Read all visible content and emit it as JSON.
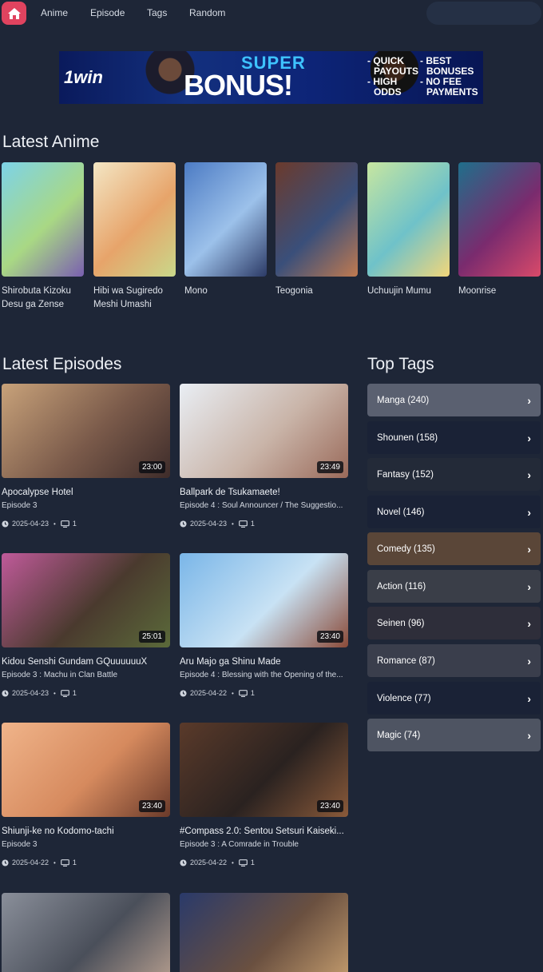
{
  "nav": {
    "links": [
      "Anime",
      "Episode",
      "Tags",
      "Random"
    ]
  },
  "banner": {
    "brand": "1win",
    "headline_top": "SUPER",
    "headline_main": "BONUS!",
    "col1": [
      "- QUICK",
      "PAYOUTS",
      "- HIGH",
      "ODDS"
    ],
    "col2": [
      "- BEST",
      "BONUSES",
      "- NO FEE",
      "PAYMENTS"
    ]
  },
  "latest_anime": {
    "heading": "Latest Anime",
    "items": [
      {
        "title": "Shirobuta Kizoku Desu ga Zense no...",
        "colors": [
          "#7dd3e8",
          "#a9d884",
          "#7a5fb0"
        ]
      },
      {
        "title": "Hibi wa Sugiredo Meshi Umashi",
        "colors": [
          "#f3e6c4",
          "#e7a46a",
          "#c9d88a"
        ]
      },
      {
        "title": "Mono",
        "colors": [
          "#4c7bc4",
          "#9cc1ea",
          "#2c3a66"
        ]
      },
      {
        "title": "Teogonia",
        "colors": [
          "#6b3a2c",
          "#3a4f7a",
          "#c07a50"
        ]
      },
      {
        "title": "Uchuujin Mumu",
        "colors": [
          "#c7e6a0",
          "#6fc2c9",
          "#f2d67a"
        ]
      },
      {
        "title": "Moonrise",
        "colors": [
          "#1f6f8b",
          "#7a2b6e",
          "#d94a6a"
        ]
      }
    ]
  },
  "latest_episodes": {
    "heading": "Latest Episodes",
    "items": [
      {
        "title": "Apocalypse Hotel",
        "subtitle": "Episode 3",
        "duration": "23:00",
        "date": "2025-04-23",
        "count": "1",
        "colors": [
          "#c8a27a",
          "#7a5a4a",
          "#3e2c2a"
        ]
      },
      {
        "title": "Ballpark de Tsukamaete!",
        "subtitle": "Episode 4 : Soul Announcer / The Suggestio...",
        "duration": "23:49",
        "date": "2025-04-23",
        "count": "1",
        "colors": [
          "#e9eef4",
          "#c9b4a8",
          "#9a6a5a"
        ]
      },
      {
        "title": "Kidou Senshi Gundam GQuuuuuuX",
        "subtitle": "Episode 3 : Machu in Clan Battle",
        "duration": "25:01",
        "date": "2025-04-23",
        "count": "1",
        "colors": [
          "#c05a9a",
          "#4a3a2e",
          "#5b6a3a"
        ]
      },
      {
        "title": "Aru Majo ga Shinu Made",
        "subtitle": "Episode 4 : Blessing with the Opening of the...",
        "duration": "23:40",
        "date": "2025-04-22",
        "count": "1",
        "colors": [
          "#7ab6e8",
          "#c8e2f4",
          "#8a4a38"
        ]
      },
      {
        "title": "Shiunji-ke no Kodomo-tachi",
        "subtitle": "Episode 3",
        "duration": "23:40",
        "date": "2025-04-22",
        "count": "1",
        "colors": [
          "#f0b48a",
          "#d68a5e",
          "#6a3a2a"
        ]
      },
      {
        "title": "#Compass 2.0: Sentou Setsuri Kaiseki...",
        "subtitle": "Episode 3 : A Comrade in Trouble",
        "duration": "23:40",
        "date": "2025-04-22",
        "count": "1",
        "colors": [
          "#5a3a2a",
          "#2a2220",
          "#8a5a3a"
        ]
      },
      {
        "title": "",
        "subtitle": "",
        "duration": "",
        "date": "",
        "count": "",
        "colors": [
          "#8a8f9a",
          "#4a4f5a",
          "#b8a090"
        ]
      },
      {
        "title": "",
        "subtitle": "",
        "duration": "",
        "date": "",
        "count": "",
        "colors": [
          "#2a3a6a",
          "#6a5040",
          "#c8a070"
        ]
      }
    ]
  },
  "top_tags": {
    "heading": "Top Tags",
    "items": [
      {
        "label": "Manga (240)",
        "bg": "#5a6070"
      },
      {
        "label": "Shounen (158)",
        "bg": "#1a2236"
      },
      {
        "label": "Fantasy (152)",
        "bg": "#232a38"
      },
      {
        "label": "Novel (146)",
        "bg": "#1a2236"
      },
      {
        "label": "Comedy (135)",
        "bg": "#5a4638"
      },
      {
        "label": "Action (116)",
        "bg": "#3a3e48"
      },
      {
        "label": "Seinen (96)",
        "bg": "#2e2e3a"
      },
      {
        "label": "Romance (87)",
        "bg": "#3a3e4c"
      },
      {
        "label": "Violence (77)",
        "bg": "#1a2236"
      },
      {
        "label": "Magic (74)",
        "bg": "#4e5462"
      }
    ]
  }
}
